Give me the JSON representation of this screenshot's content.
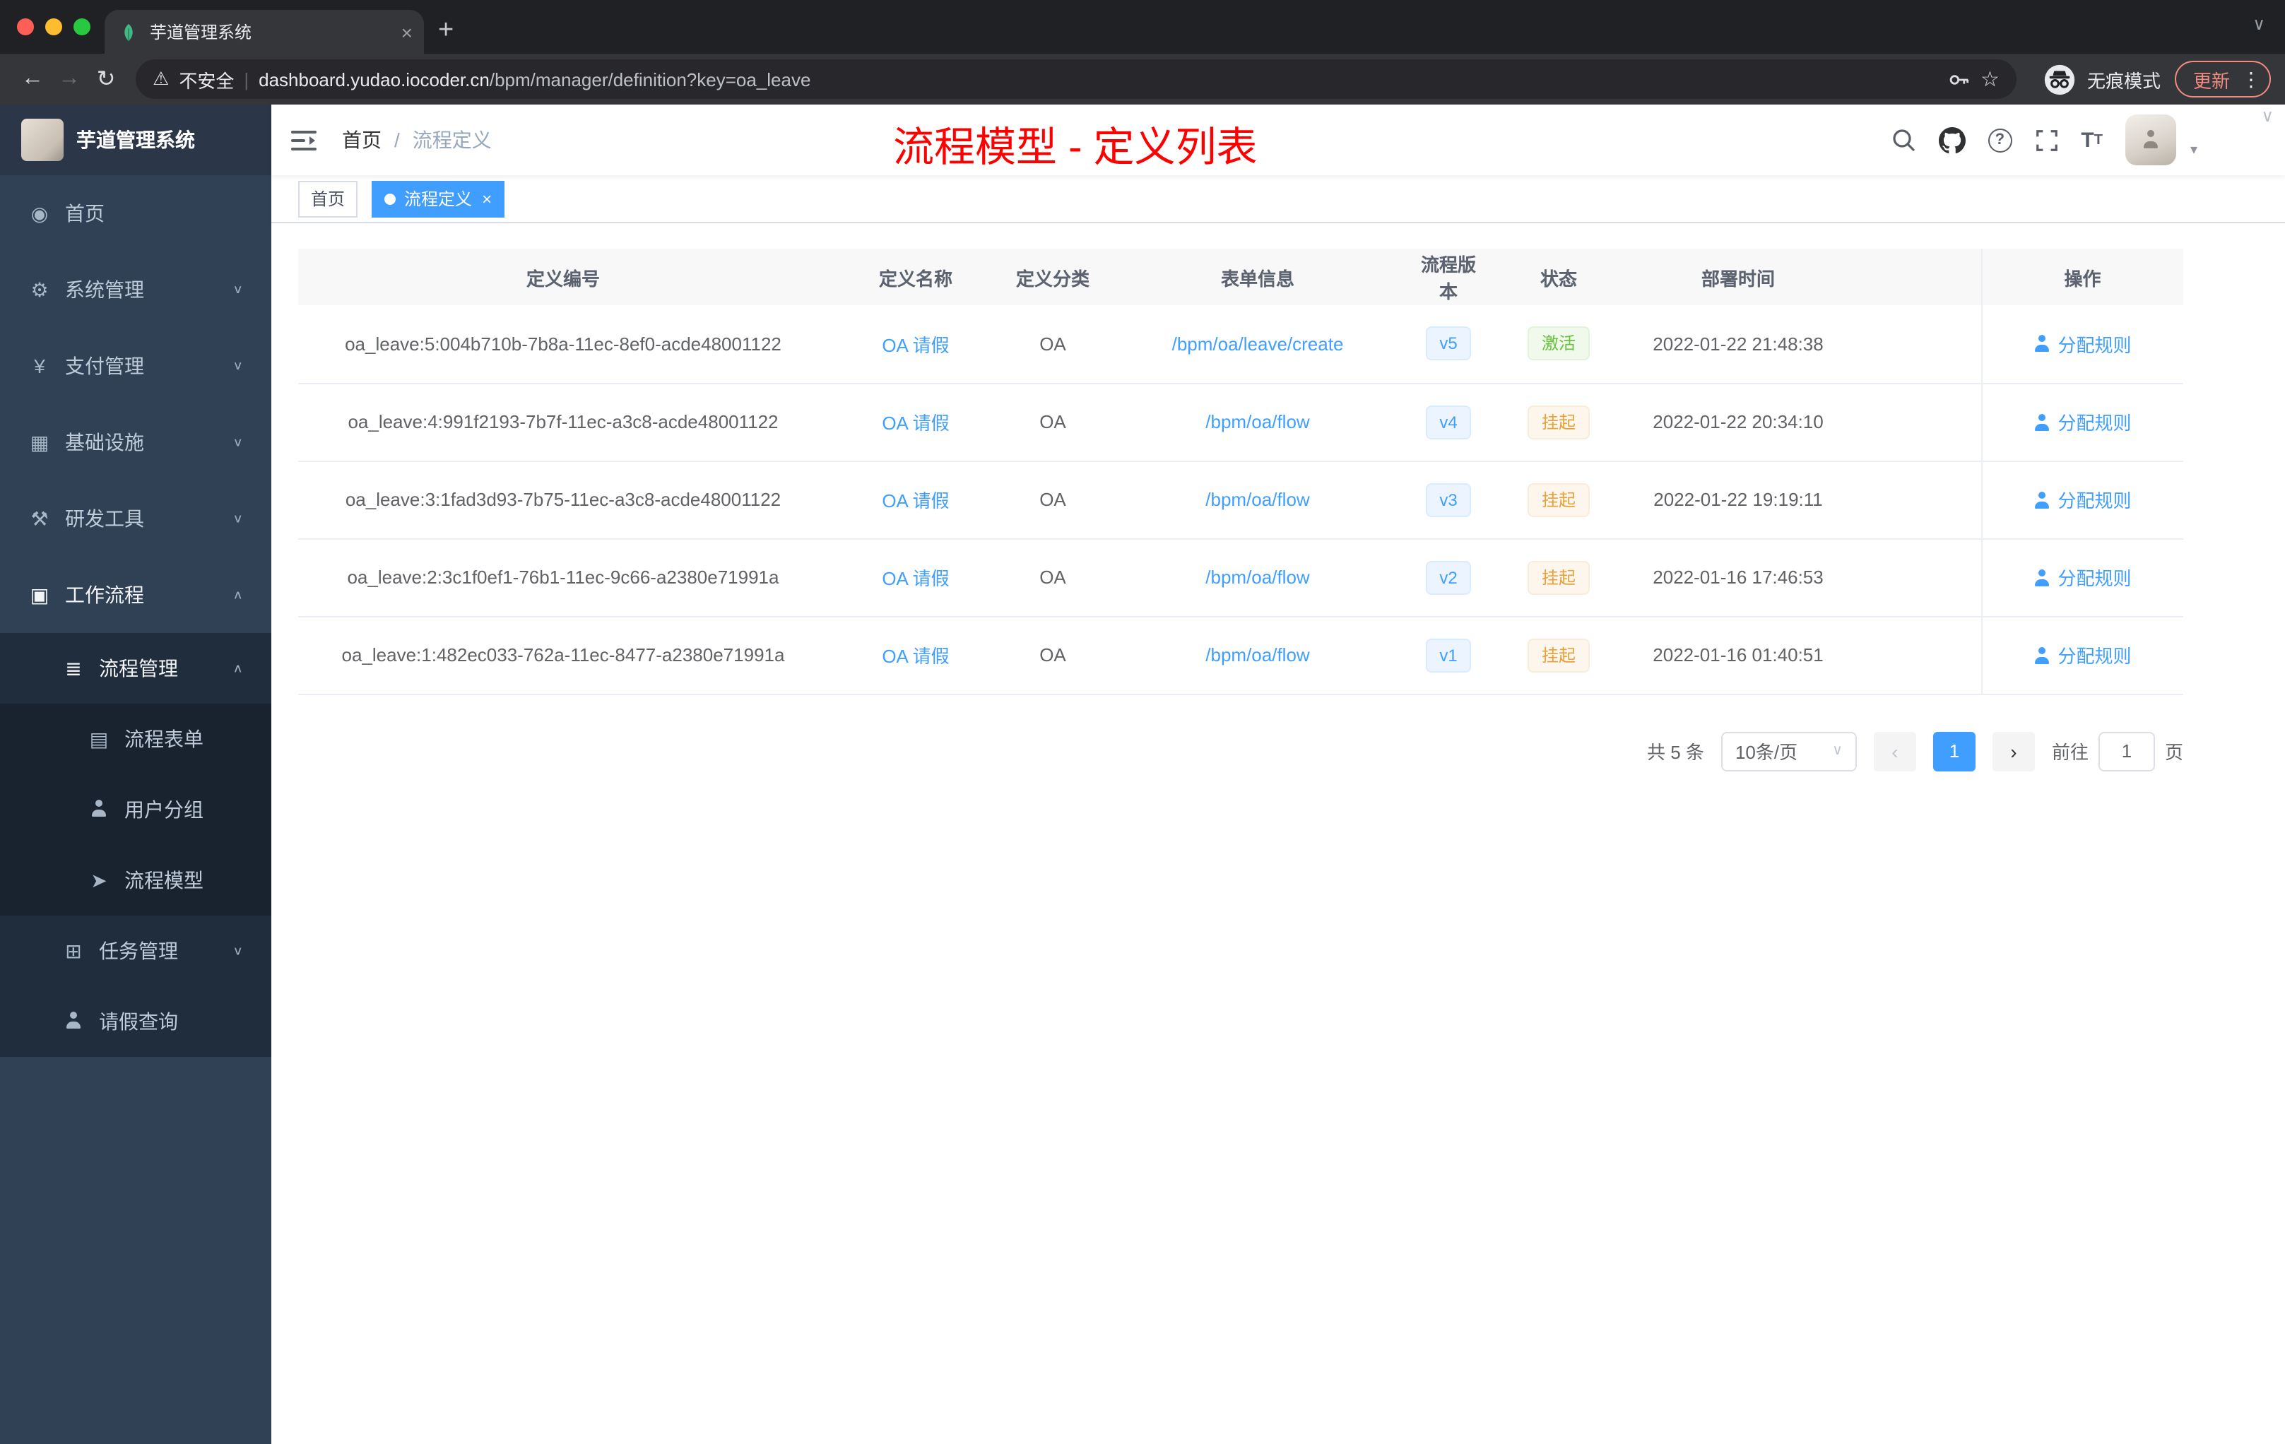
{
  "browser": {
    "tab_title": "芋道管理系统",
    "security_label": "不安全",
    "url_host": "dashboard.yudao.iocoder.cn",
    "url_path": "/bpm/manager/definition?key=oa_leave",
    "incognito_label": "无痕模式",
    "update_label": "更新"
  },
  "icons": {
    "back": "←",
    "forward": "→",
    "reload": "↻",
    "warning": "⚠",
    "divider": "|",
    "star": "☆",
    "more": "⋮",
    "close": "×",
    "new_tab": "+",
    "chevron_down": "∨",
    "chevron_up": "∧",
    "caret_down": "▾",
    "dashboard": "◉",
    "gear": "⚙",
    "yen": "¥",
    "grid": "▦",
    "hammer": "⚒",
    "monitor": "▣",
    "list": "≣",
    "document": "▤",
    "send": "➤",
    "tree": "⊞",
    "prev": "‹",
    "next": "›",
    "question": "?",
    "font_big": "T",
    "font_small": "T"
  },
  "sidebar": {
    "logo_title": "芋道管理系统",
    "items": [
      {
        "name": "home",
        "label": "首页",
        "icon": "dashboard-icon",
        "glyph": "dashboard",
        "level": 1,
        "arrow": null,
        "active": false
      },
      {
        "name": "system-management",
        "label": "系统管理",
        "icon": "gear-icon",
        "glyph": "gear",
        "level": 1,
        "arrow": "down",
        "active": false
      },
      {
        "name": "payment-management",
        "label": "支付管理",
        "icon": "yen-icon",
        "glyph": "yen",
        "level": 1,
        "arrow": "down",
        "active": false
      },
      {
        "name": "infrastructure",
        "label": "基础设施",
        "icon": "grid-icon",
        "glyph": "grid",
        "level": 1,
        "arrow": "down",
        "active": false
      },
      {
        "name": "dev-tools",
        "label": "研发工具",
        "icon": "tools-icon",
        "glyph": "hammer",
        "level": 1,
        "arrow": "down",
        "active": false
      },
      {
        "name": "workflow",
        "label": "工作流程",
        "icon": "briefcase-icon",
        "glyph": "monitor",
        "level": 1,
        "arrow": "up",
        "active": true
      },
      {
        "name": "process-management",
        "label": "流程管理",
        "icon": "list-icon",
        "glyph": "list",
        "level": 2,
        "arrow": "up",
        "active": true
      },
      {
        "name": "process-form",
        "label": "流程表单",
        "icon": "document-icon",
        "glyph": "document",
        "level": 3,
        "arrow": null,
        "active": false
      },
      {
        "name": "user-group",
        "label": "用户分组",
        "icon": "users-icon",
        "glyph": "person",
        "level": 3,
        "arrow": null,
        "active": false
      },
      {
        "name": "process-model",
        "label": "流程模型",
        "icon": "paper-plane-icon",
        "glyph": "send",
        "level": 3,
        "arrow": null,
        "active": false
      },
      {
        "name": "task-management",
        "label": "任务管理",
        "icon": "tree-icon",
        "glyph": "tree",
        "level": 2,
        "arrow": "down",
        "active": false
      },
      {
        "name": "leave-query",
        "label": "请假查询",
        "icon": "person-icon",
        "glyph": "person",
        "level": 2,
        "arrow": null,
        "active": false
      }
    ]
  },
  "navbar": {
    "breadcrumb_home": "首页",
    "breadcrumb_sep": "/",
    "breadcrumb_current": "流程定义",
    "annotation": "流程模型 - 定义列表"
  },
  "tags": [
    {
      "name": "home",
      "label": "首页",
      "active": false
    },
    {
      "name": "definition",
      "label": "流程定义",
      "active": true
    }
  ],
  "table": {
    "columns": [
      "定义编号",
      "定义名称",
      "定义分类",
      "表单信息",
      "流程版本",
      "状态",
      "部署时间",
      "操作"
    ],
    "rows": [
      {
        "id": "oa_leave:5:004b710b-7b8a-11ec-8ef0-acde48001122",
        "name": "OA 请假",
        "category": "OA",
        "form": "/bpm/oa/leave/create",
        "version": "v5",
        "status": "激活",
        "status_type": "success",
        "time": "2022-01-22 21:48:38",
        "action": "分配规则"
      },
      {
        "id": "oa_leave:4:991f2193-7b7f-11ec-a3c8-acde48001122",
        "name": "OA 请假",
        "category": "OA",
        "form": "/bpm/oa/flow",
        "version": "v4",
        "status": "挂起",
        "status_type": "warning",
        "time": "2022-01-22 20:34:10",
        "action": "分配规则"
      },
      {
        "id": "oa_leave:3:1fad3d93-7b75-11ec-a3c8-acde48001122",
        "name": "OA 请假",
        "category": "OA",
        "form": "/bpm/oa/flow",
        "version": "v3",
        "status": "挂起",
        "status_type": "warning",
        "time": "2022-01-22 19:19:11",
        "action": "分配规则"
      },
      {
        "id": "oa_leave:2:3c1f0ef1-76b1-11ec-9c66-a2380e71991a",
        "name": "OA 请假",
        "category": "OA",
        "form": "/bpm/oa/flow",
        "version": "v2",
        "status": "挂起",
        "status_type": "warning",
        "time": "2022-01-16 17:46:53",
        "action": "分配规则"
      },
      {
        "id": "oa_leave:1:482ec033-762a-11ec-8477-a2380e71991a",
        "name": "OA 请假",
        "category": "OA",
        "form": "/bpm/oa/flow",
        "version": "v1",
        "status": "挂起",
        "status_type": "warning",
        "time": "2022-01-16 01:40:51",
        "action": "分配规则"
      }
    ]
  },
  "pagination": {
    "total": "共 5 条",
    "page_size": "10条/页",
    "page": "1",
    "goto": "前往",
    "goto_value": "1",
    "unit": "页"
  }
}
